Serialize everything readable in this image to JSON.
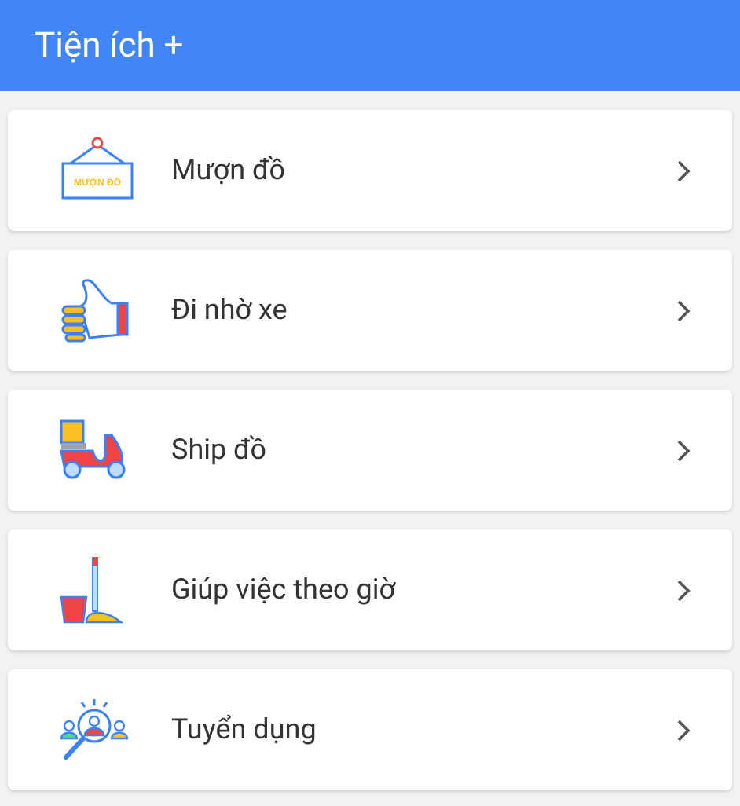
{
  "header": {
    "title": "Tiện ích +"
  },
  "items": [
    {
      "kind": "sign",
      "label": "Mượn đồ",
      "sign_text": "MƯỢN ĐỒ"
    },
    {
      "kind": "hand",
      "label": "Đi nhờ xe"
    },
    {
      "kind": "scooter",
      "label": "Ship đồ"
    },
    {
      "kind": "mop",
      "label": "Giúp việc theo giờ"
    },
    {
      "kind": "recruit",
      "label": "Tuyển dụng"
    }
  ]
}
